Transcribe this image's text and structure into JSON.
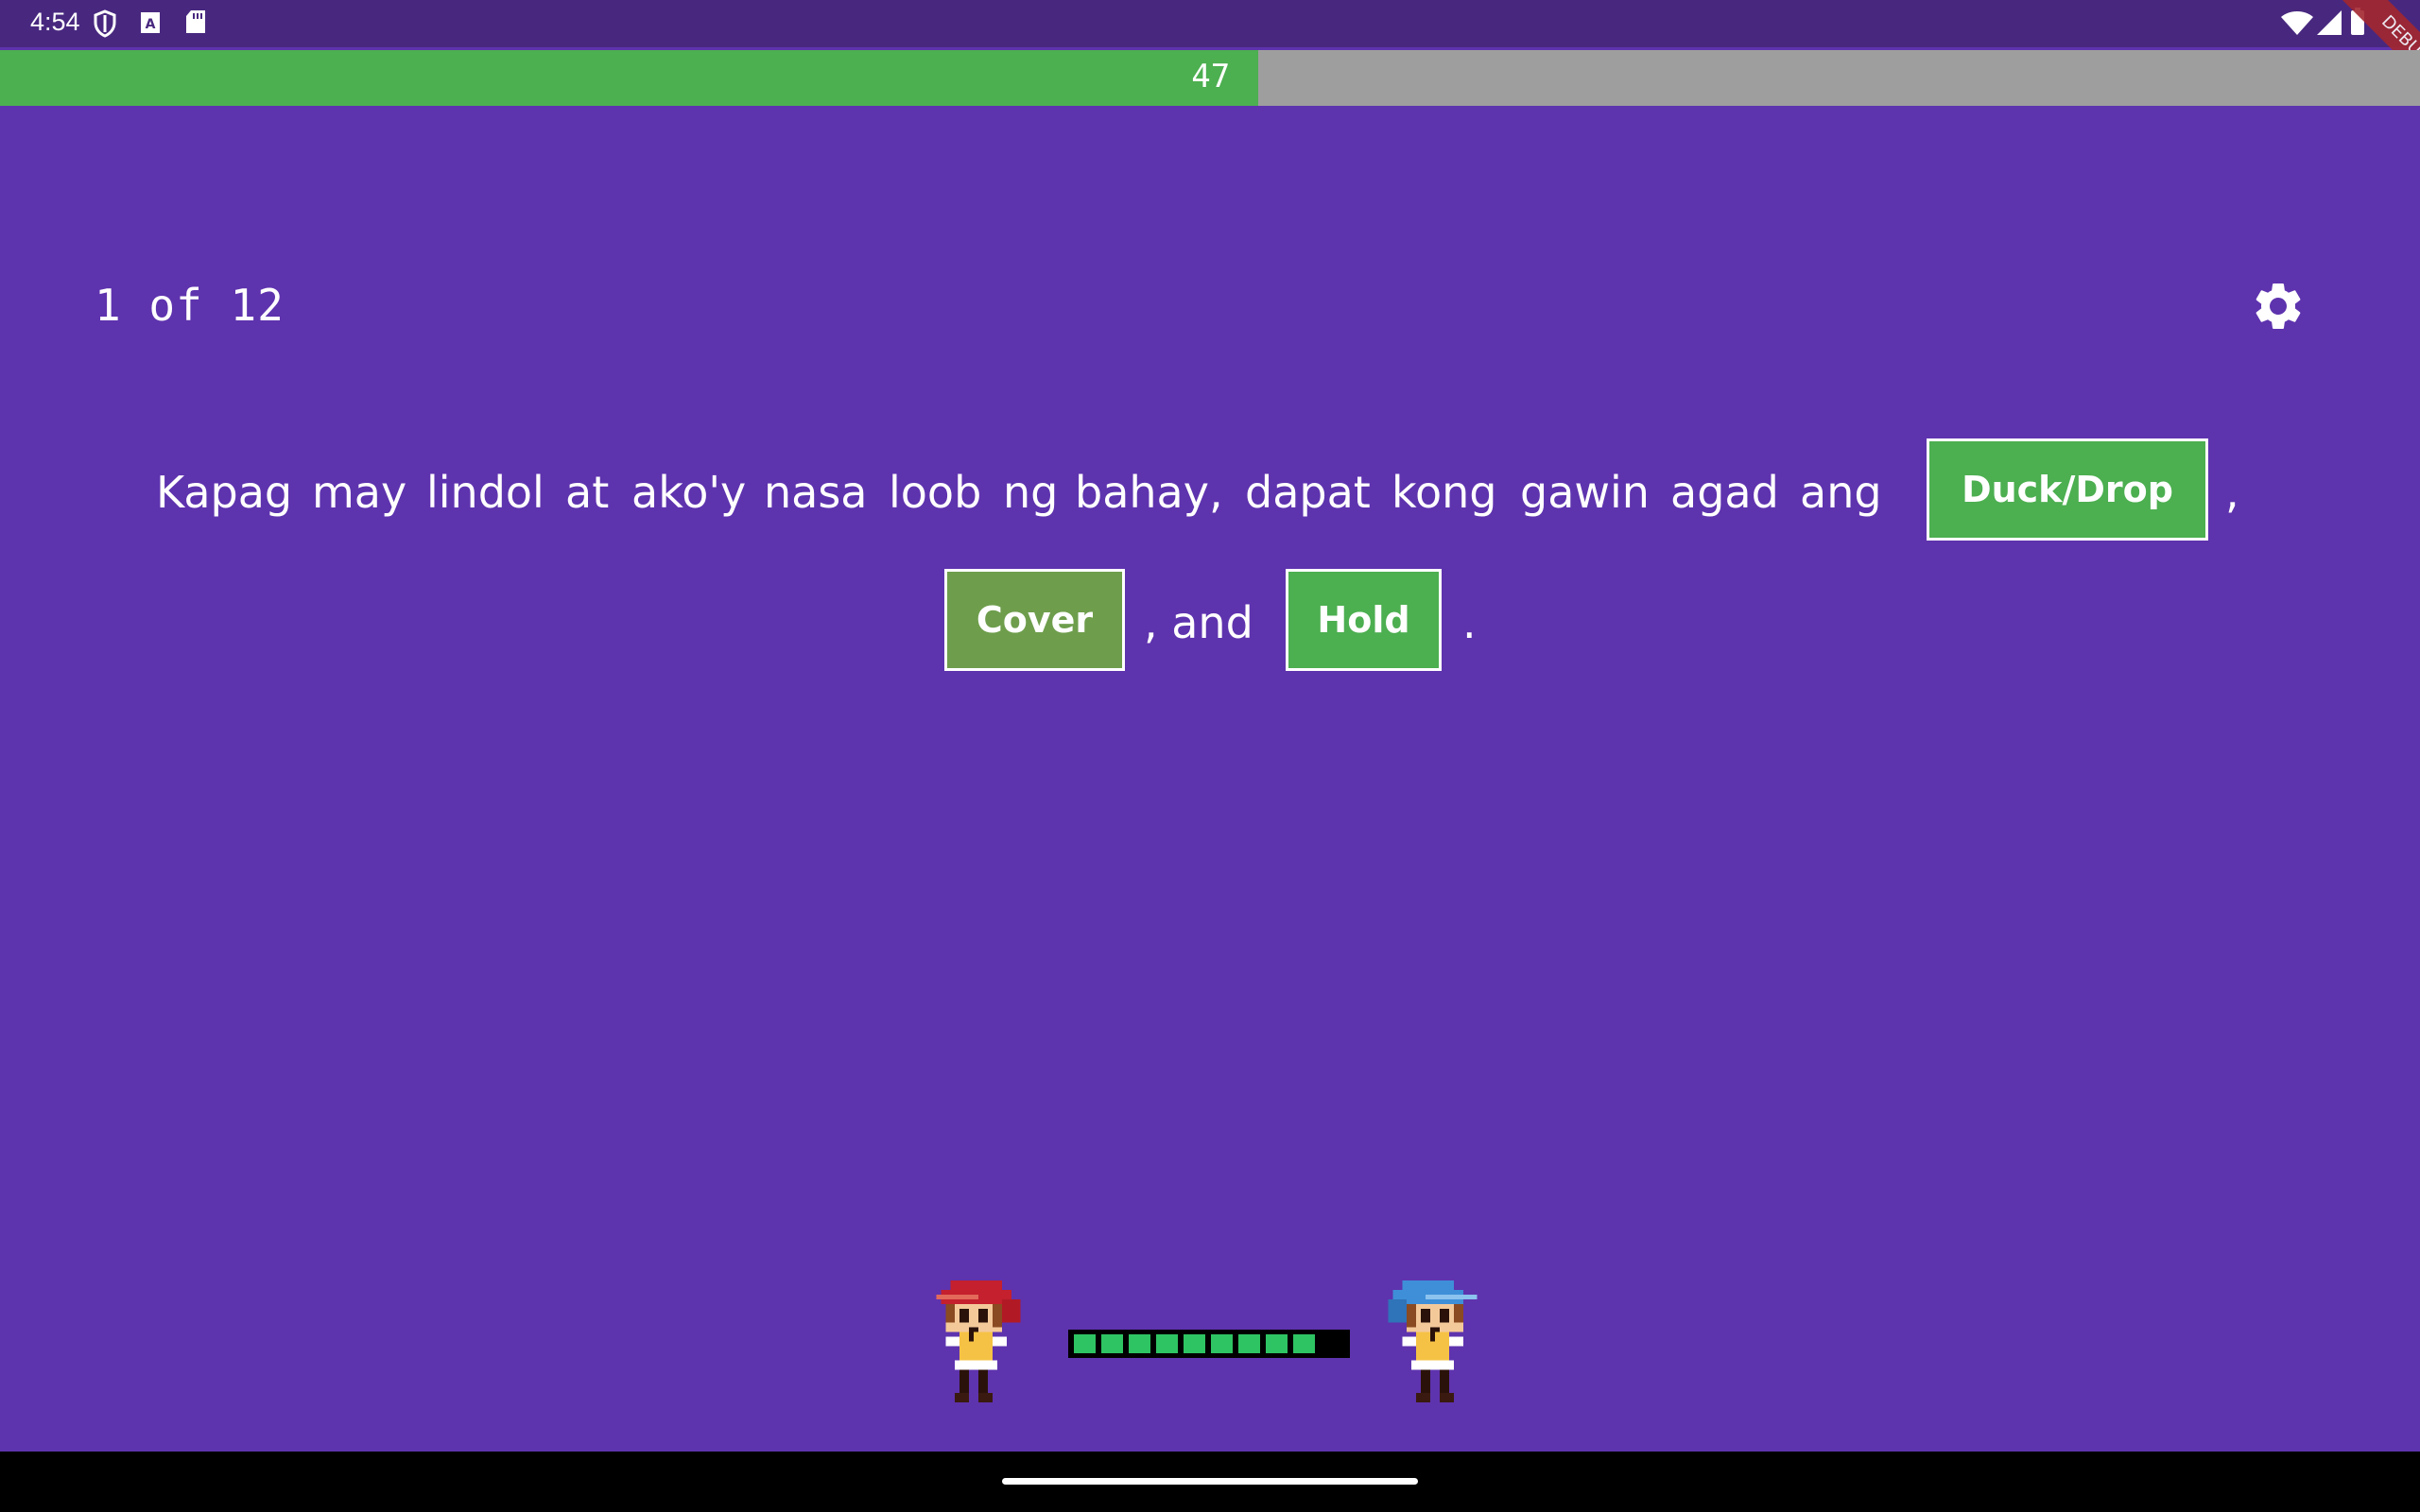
{
  "status_bar": {
    "time": "4:54"
  },
  "debug_banner": "DEBUG",
  "timer": {
    "value": "47",
    "fraction_remaining": 0.52
  },
  "header": {
    "counter": "1 of 12",
    "settings_icon": "gear-icon"
  },
  "sentence": {
    "line1": [
      "Kapag",
      "may",
      "lindol",
      "at",
      "ako'y",
      "nasa",
      "loob",
      "ng",
      "bahay,",
      "dapat",
      "kong",
      "gawin",
      "agad",
      "ang"
    ],
    "blank1": "Duck/Drop",
    "comma1": ",",
    "blank2": "Cover",
    "and_text": ", and",
    "blank3": "Hold",
    "period": "."
  },
  "battle": {
    "player": "red-hair-character",
    "opponent": "blue-hair-character",
    "health_segments": 9
  },
  "colors": {
    "background": "#5e33ae",
    "status_bar": "#48287f",
    "timer_fill": "#4caf50",
    "timer_track": "#9e9e9e",
    "blank_fill": "#4caf50"
  }
}
